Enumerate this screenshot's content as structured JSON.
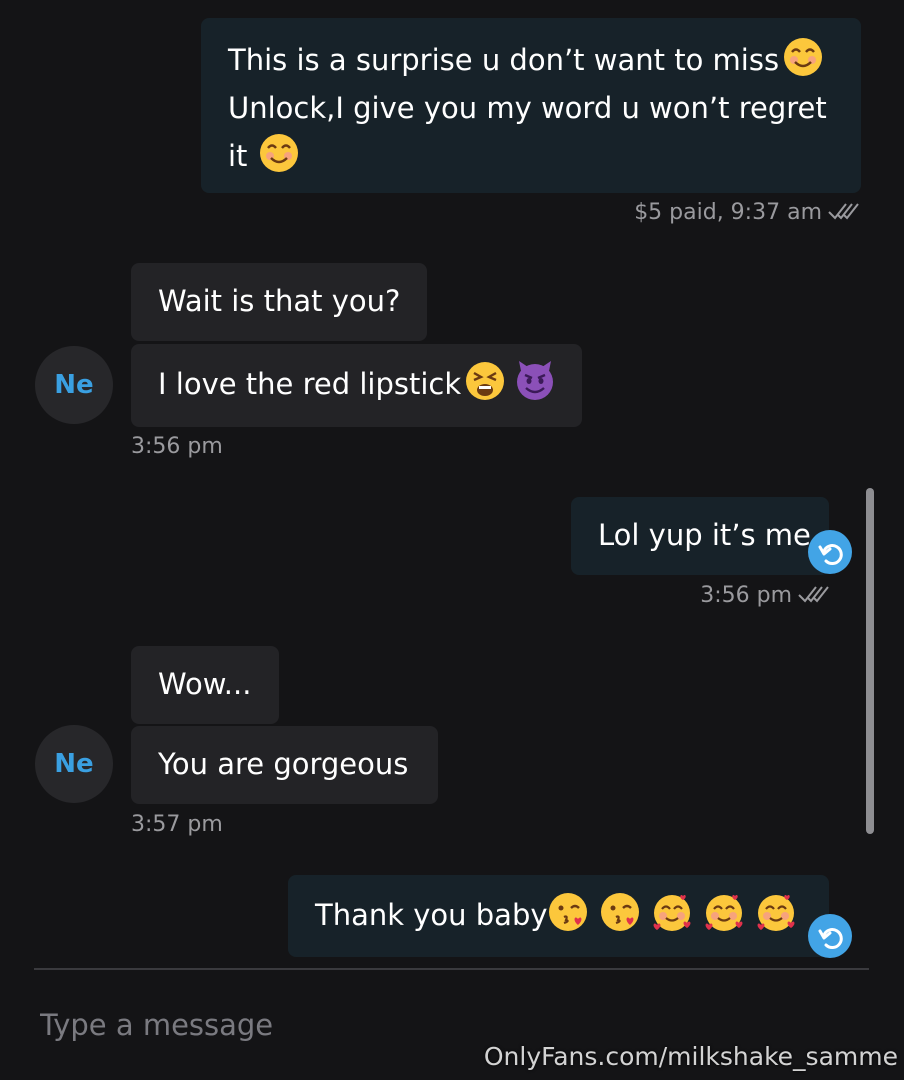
{
  "messages": {
    "m1": {
      "line1": "This is a surprise u don’t want to miss",
      "line2": "Unlock,I give you my word u won’t regret",
      "line3": "it",
      "meta": "$5 paid, 9:37 am"
    },
    "m2": {
      "text": "Wait is that you?"
    },
    "m3": {
      "text": "I love the red lipstick",
      "avatar": "Ne",
      "time": "3:56 pm"
    },
    "m4": {
      "text": "Lol yup it’s me",
      "time": "3:56 pm"
    },
    "m5": {
      "text": "Wow..."
    },
    "m6": {
      "text": "You are gorgeous",
      "avatar": "Ne",
      "time": "3:57 pm"
    },
    "m7": {
      "text": "Thank you baby"
    }
  },
  "composer": {
    "placeholder": "Type a message"
  },
  "watermark": "OnlyFans.com/milkshake_samme",
  "icons": {
    "smile": "smiling-face-icon",
    "tired": "tired-face-icon",
    "devil": "smiling-imp-icon",
    "kiss": "face-blowing-kiss-icon",
    "hearts": "smiling-face-with-hearts-icon",
    "reply": "reply-icon",
    "read": "double-check-icon"
  },
  "colors": {
    "accent": "#42a4e6",
    "outgoing_bubble": "#172229",
    "incoming_bubble": "#232326",
    "background": "#141416"
  }
}
